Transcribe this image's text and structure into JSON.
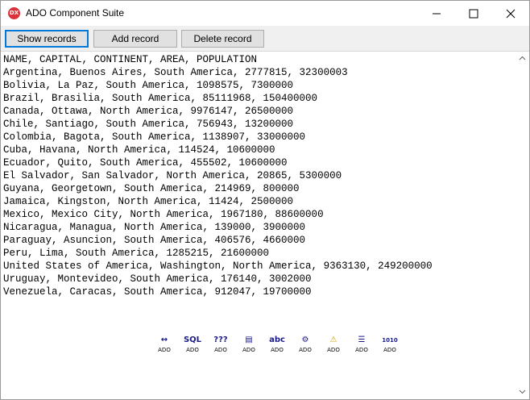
{
  "window": {
    "title": "ADO Component Suite",
    "icon_text": "DX",
    "controls": {
      "minimize": "minimize-icon",
      "maximize": "maximize-icon",
      "close": "close-icon"
    }
  },
  "toolbar": {
    "show_label": "Show records",
    "add_label": "Add record",
    "delete_label": "Delete record"
  },
  "records": {
    "lines": [
      "NAME, CAPITAL, CONTINENT, AREA, POPULATION",
      "Argentina, Buenos Aires, South America, 2777815, 32300003",
      "Bolivia, La Paz, South America, 1098575, 7300000",
      "Brazil, Brasilia, South America, 85111968, 150400000",
      "Canada, Ottawa, North America, 9976147, 26500000",
      "Chile, Santiago, South America, 756943, 13200000",
      "Colombia, Bagota, South America, 1138907, 33000000",
      "Cuba, Havana, North America, 114524, 10600000",
      "Ecuador, Quito, South America, 455502, 10600000",
      "El Salvador, San Salvador, North America, 20865, 5300000",
      "Guyana, Georgetown, South America, 214969, 800000",
      "Jamaica, Kingston, North America, 11424, 2500000",
      "Mexico, Mexico City, North America, 1967180, 88600000",
      "Nicaragua, Managua, North America, 139000, 3900000",
      "Paraguay, Asuncion, South America, 406576, 4660000",
      "Peru, Lima, South America, 1285215, 21600000",
      "United States of America, Washington, North America, 9363130, 249200000",
      "Uruguay, Montevideo, South America, 176140, 3002000",
      "Venezuela, Caracas, South America, 912047, 19700000"
    ]
  },
  "ado_components": [
    {
      "icon": "ado-connection-icon",
      "glyph": "↔",
      "caption": "ADO"
    },
    {
      "icon": "ado-sql-icon",
      "glyph": "SQL",
      "caption": "ADO"
    },
    {
      "icon": "ado-query-icon",
      "glyph": "???",
      "caption": "ADO"
    },
    {
      "icon": "ado-table-icon",
      "glyph": "▤",
      "caption": "ADO"
    },
    {
      "icon": "ado-text-icon",
      "glyph": "abc",
      "caption": "ADO"
    },
    {
      "icon": "ado-dataset-icon",
      "glyph": "⚙",
      "caption": "ADO"
    },
    {
      "icon": "ado-warning-icon",
      "glyph": "⚠",
      "caption": "ADO"
    },
    {
      "icon": "ado-list-icon",
      "glyph": "☰",
      "caption": "ADO"
    },
    {
      "icon": "ado-binary-icon",
      "glyph": "1010",
      "caption": "ADO"
    }
  ]
}
